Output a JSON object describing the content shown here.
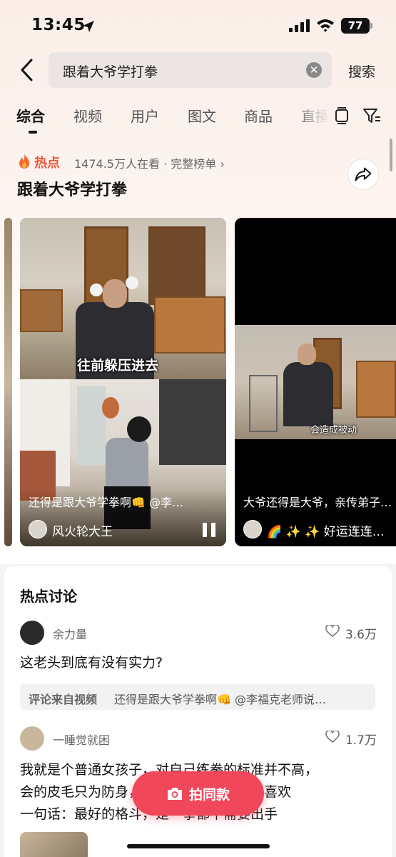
{
  "status_bar": {
    "time": "13:45",
    "battery": "77"
  },
  "search": {
    "query": "跟着大爷学打拳",
    "clear_symbol": "✕",
    "submit_label": "搜索"
  },
  "tabs": [
    {
      "label": "综合",
      "active": true
    },
    {
      "label": "视频"
    },
    {
      "label": "用户"
    },
    {
      "label": "图文"
    },
    {
      "label": "商品"
    },
    {
      "label": "直播"
    }
  ],
  "hot": {
    "badge": "热点",
    "viewers": "1474.5万人在看 · 完整榜单 ›",
    "title": "跟着大爷学打拳"
  },
  "videos": [
    {
      "subtitle_top": "往前躲压进去",
      "caption": "还得是跟大爷学拳啊👊 @李…",
      "author": "风火轮大王"
    },
    {
      "subtitle": "会造成被动",
      "caption": "大爷还得是大爷，亲传弟子…",
      "author": "🌈 ✨ ✨ 好运连连…"
    }
  ],
  "discussion": {
    "title": "热点讨论",
    "posts": [
      {
        "user": "余力量",
        "likes": "3.6万",
        "text": "这老头到底有没有实力?",
        "quote_label": "评论来自视频",
        "quote_text": "还得是跟大爷学拳啊👊 @李福克老师说…"
      },
      {
        "user": "一睡觉就困",
        "likes": "1.7万",
        "text_lines": [
          "我就是个普通女孩子，对自己练拳的标准并不高，",
          "会的皮毛只为防身，别的就不多用啦。很喜欢",
          "一句话：最好的格斗，是一拳都不需要出手"
        ]
      }
    ]
  },
  "float_button": {
    "label": "拍同款"
  },
  "colors": {
    "accent": "#f1475a",
    "hot": "#f2563b"
  }
}
